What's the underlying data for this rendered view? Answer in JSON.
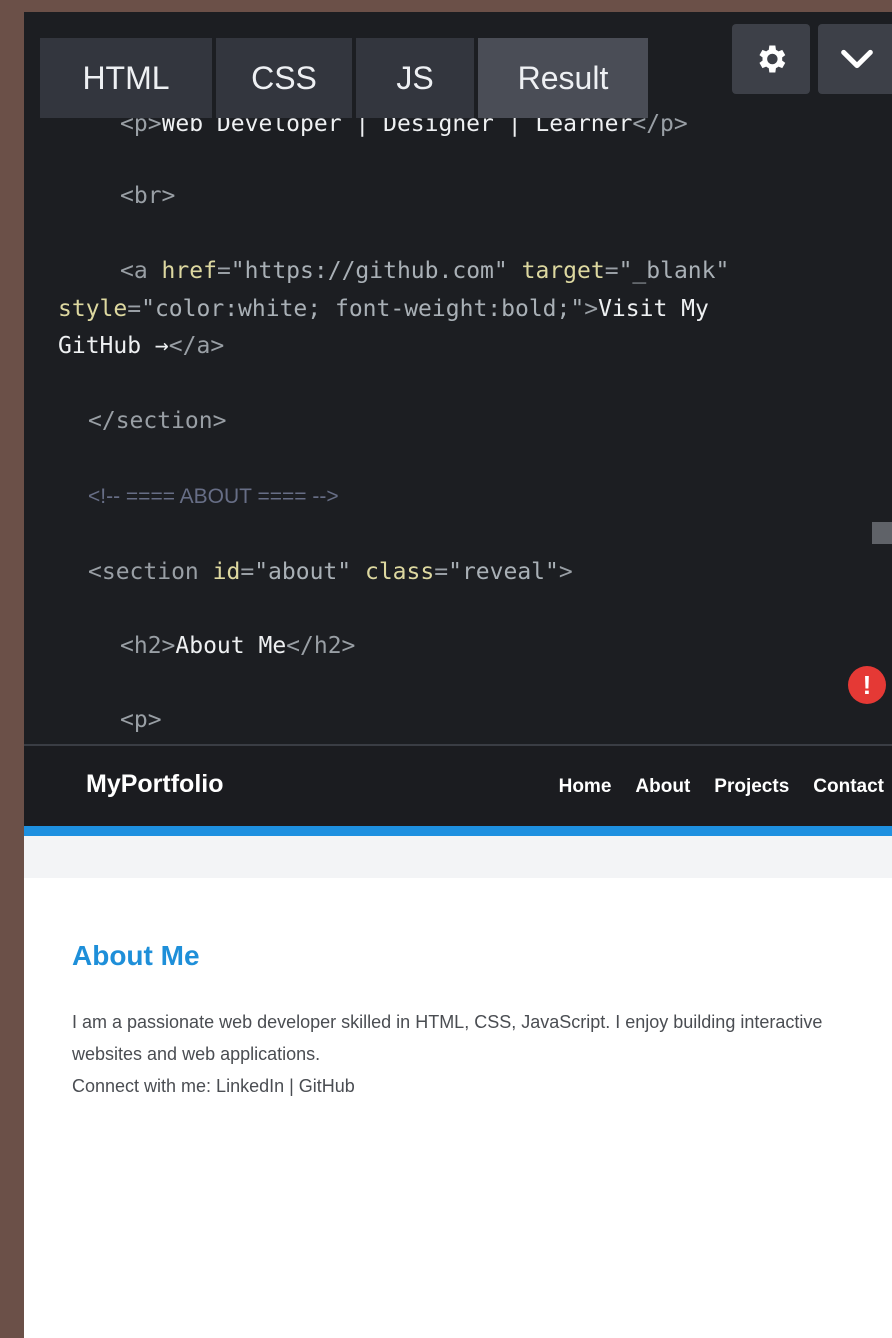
{
  "editor": {
    "tabs": [
      "HTML",
      "CSS",
      "JS",
      "Result"
    ],
    "active_tab": "Result",
    "settings_icon": "gear-icon",
    "collapse_icon": "chevron-down-icon",
    "error_badge": "!",
    "code_lines": {
      "l0": {
        "open": "<p>",
        "text": "Web Developer | Designer | Learner",
        "close": "</p>"
      },
      "l1": {
        "tag": "<br>"
      },
      "l2": {
        "p1": "<a ",
        "a1": "href",
        "eq1": "=",
        "v1": "\"https://github.com\"",
        "sp": " ",
        "a2": "target",
        "eq2": "=",
        "v2": "\"_blank\""
      },
      "l3": {
        "a3": "style",
        "eq3": "=",
        "v3": "\"color:white; font-weight:bold;\"",
        "gt": ">",
        "text": "Visit My"
      },
      "l4": {
        "text": "GitHub →",
        "close": "</a>"
      },
      "l5": {
        "tag": "</section>"
      },
      "l6": {
        "comment": "<!-- ==== ABOUT ==== -->"
      },
      "l7": {
        "open": "<section ",
        "a1": "id",
        "eq1": "=",
        "v1": "\"about\"",
        "sp": " ",
        "a2": "class",
        "eq2": "=",
        "v2": "\"reveal\"",
        "gt": ">"
      },
      "l8": {
        "open": "<h2>",
        "text": "About Me",
        "close": "</h2>"
      },
      "l9": {
        "tag": "<p>"
      }
    }
  },
  "result": {
    "nav": {
      "brand": "MyPortfolio",
      "links": [
        "Home",
        "About",
        "Projects",
        "Contact"
      ]
    },
    "about": {
      "title": "About Me",
      "line1": "I am a passionate web developer skilled in HTML, CSS, JavaScript. I enjoy building interactive websites and web applications.",
      "line2": "Connect with me: LinkedIn | GitHub"
    }
  },
  "colors": {
    "accent": "#1e90e0",
    "error": "#e53935"
  }
}
